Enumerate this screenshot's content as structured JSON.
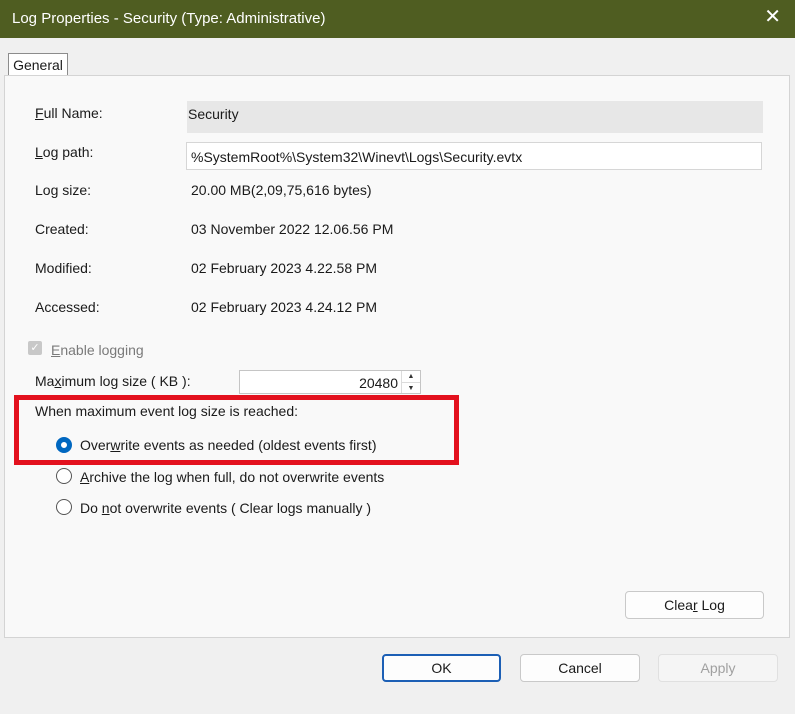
{
  "window": {
    "title": "Log Properties - Security (Type: Administrative)",
    "close_glyph": "✕"
  },
  "tabs": [
    {
      "label": "General",
      "selected": true
    }
  ],
  "fields": {
    "full_name_label": "Full Name:",
    "full_name_value": "Security",
    "log_path_label": "Log path:",
    "log_path_value": "%SystemRoot%\\System32\\Winevt\\Logs\\Security.evtx",
    "log_size_label": "Log size:",
    "log_size_value": "20.00 MB(2,09,75,616 bytes)",
    "created_label": "Created:",
    "created_value": "03 November 2022 12.06.56 PM",
    "modified_label": "Modified:",
    "modified_value": "02 February 2023 4.22.58 PM",
    "accessed_label": "Accessed:",
    "accessed_value": "02 February 2023 4.24.12 PM"
  },
  "enable_logging": {
    "label": "Enable logging",
    "checked": true,
    "disabled": true
  },
  "max_size": {
    "label": "Maximum log size ( KB ):",
    "value": "20480"
  },
  "policy": {
    "heading": "When maximum event log size is reached:",
    "options": [
      {
        "label": "Overwrite events as needed (oldest events first)",
        "selected": true
      },
      {
        "label": "Archive the log when full, do not overwrite events",
        "selected": false
      },
      {
        "label": "Do not overwrite events ( Clear logs manually )",
        "selected": false
      }
    ]
  },
  "buttons": {
    "clear_log": "Clear Log",
    "ok": "OK",
    "cancel": "Cancel",
    "apply": "Apply"
  },
  "colors": {
    "titlebar": "#4f5d21",
    "highlight_border": "#e3111e",
    "radio_accent": "#0067c0"
  }
}
